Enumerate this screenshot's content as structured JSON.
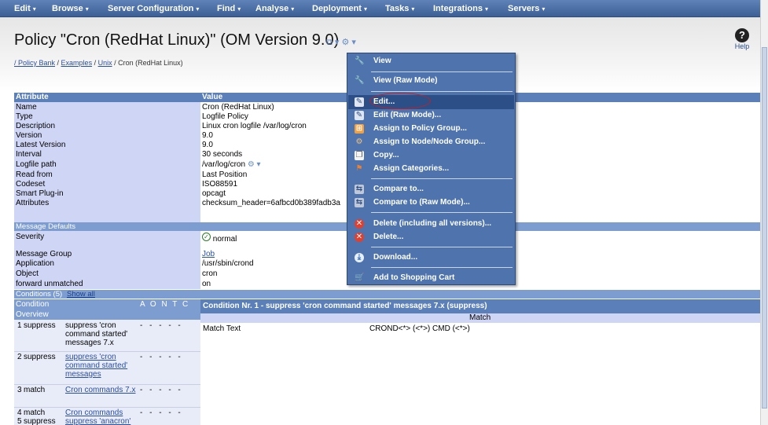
{
  "menubar": {
    "items": [
      "Edit",
      "Browse",
      "Server Configuration",
      "Find",
      "Analyse",
      "Deployment",
      "Tasks",
      "Integrations",
      "Servers"
    ],
    "caret": "▾"
  },
  "title": "Policy \"Cron (RedHat Linux)\" (OM Version 9.0)",
  "title_icons": "⧉ ▾ ⚙ ▾",
  "help": {
    "icon": "?",
    "label": "Help"
  },
  "breadcrumb": {
    "items": [
      "/ Policy Bank",
      "Examples",
      "Unix"
    ],
    "separator": " / ",
    "current": "Cron (RedHat Linux)"
  },
  "attr_table": {
    "headers": {
      "attribute": "Attribute",
      "value": "Value"
    },
    "rows": [
      {
        "k": "Name",
        "v": "Cron (RedHat Linux)"
      },
      {
        "k": "Type",
        "v": "Logfile Policy"
      },
      {
        "k": "Description",
        "v": "Linux cron logfile /var/log/cron"
      },
      {
        "k": "Version",
        "v": "9.0"
      },
      {
        "k": "Latest Version",
        "v": "9.0"
      },
      {
        "k": "Interval",
        "v": "30  seconds"
      },
      {
        "k": "Logfile path",
        "v": "/var/log/cron"
      },
      {
        "k": "Read from",
        "v": "Last Position"
      },
      {
        "k": "Codeset",
        "v": "ISO88591"
      },
      {
        "k": "Smart Plug-in",
        "v": "opcagt"
      },
      {
        "k": "Attributes",
        "v": "checksum_header=6afbcd0b389fadb3a"
      }
    ]
  },
  "message_defaults": {
    "title": "Message Defaults",
    "severity_label": "Severity",
    "severity_value": "normal",
    "rows": [
      {
        "k": "Message Group",
        "v": "Job",
        "link": true
      },
      {
        "k": "Application",
        "v": "/usr/sbin/crond",
        "link": false
      },
      {
        "k": "Object",
        "v": "cron",
        "link": false
      },
      {
        "k": "forward unmatched",
        "v": "on",
        "link": false
      }
    ]
  },
  "conditions": {
    "title": "Conditions (5)",
    "show_all": "Show all",
    "col_condition": "Condition",
    "col_overview": "Overview",
    "flag_headers": "A O N T C",
    "items": [
      {
        "num": "1",
        "type": "suppress",
        "desc": "suppress 'cron command started' messages 7.x",
        "link": false,
        "flags": "- - - - -"
      },
      {
        "num": "2",
        "type": "suppress",
        "desc": "suppress 'cron command started' messages",
        "link": true,
        "flags": "- - - - -"
      },
      {
        "num": "3",
        "type": "match",
        "desc": "Cron commands 7.x",
        "link": true,
        "flags": "- - - - -"
      },
      {
        "num": "4",
        "type": "match",
        "desc": "Cron commands",
        "link": true,
        "flags": "- - - - -"
      },
      {
        "num": "5",
        "type": "suppress",
        "desc": "suppress 'anacron'",
        "link": true,
        "flags": ""
      }
    ]
  },
  "condition_detail": {
    "title": "Condition Nr. 1 - suppress 'cron command started' messages 7.x (suppress)",
    "match_header": "Match",
    "match_label": "Match Text",
    "match_value": "CROND<*> (<*>) CMD (<*>)"
  },
  "context_menu": {
    "items": [
      {
        "label": "View",
        "icon": "wrench-icon",
        "glyph": "🔧",
        "color": "#d8d8d8"
      },
      {
        "label": "View (Raw Mode)",
        "icon": "wrench-icon",
        "glyph": "🔧",
        "color": "#d8d8d8"
      },
      {
        "label": "Edit...",
        "icon": "edit-icon",
        "glyph": "✎",
        "color": "#9fb3d8",
        "highlighted": true
      },
      {
        "label": "Edit (Raw Mode)...",
        "icon": "edit-raw-icon",
        "glyph": "✎",
        "color": "#9fb3d8"
      },
      {
        "label": "Assign to Policy Group...",
        "icon": "assign-group-icon",
        "glyph": "⊞",
        "color": "#f0a040"
      },
      {
        "label": "Assign to Node/Node Group...",
        "icon": "assign-node-icon",
        "glyph": "⚙",
        "color": "#c07040"
      },
      {
        "label": "Copy...",
        "icon": "copy-icon",
        "glyph": "❐",
        "color": "#e0e0e0"
      },
      {
        "label": "Assign Categories...",
        "icon": "categories-icon",
        "glyph": "⚑",
        "color": "#f08030"
      },
      {
        "label": "Compare to...",
        "icon": "compare-icon",
        "glyph": "⇆",
        "color": "#c0c8d8"
      },
      {
        "label": "Compare to (Raw Mode)...",
        "icon": "compare-raw-icon",
        "glyph": "⇆",
        "color": "#c0c8d8"
      },
      {
        "label": "Delete (including all versions)...",
        "icon": "delete-all-icon",
        "glyph": "✕",
        "color": "#e04030"
      },
      {
        "label": "Delete...",
        "icon": "delete-icon",
        "glyph": "✕",
        "color": "#e04030"
      },
      {
        "label": "Download...",
        "icon": "download-icon",
        "glyph": "⤓",
        "color": "#4080d0"
      },
      {
        "label": "Add to Shopping Cart",
        "icon": "cart-icon",
        "glyph": "🛒",
        "color": "#80b040"
      }
    ]
  },
  "colors": {
    "menubar": "#4a6fa8",
    "header": "#5b7fb8",
    "label_bg": "#cfd6f5",
    "menu_bg": "#4f74ad",
    "highlight_oval": "#c0202a"
  }
}
